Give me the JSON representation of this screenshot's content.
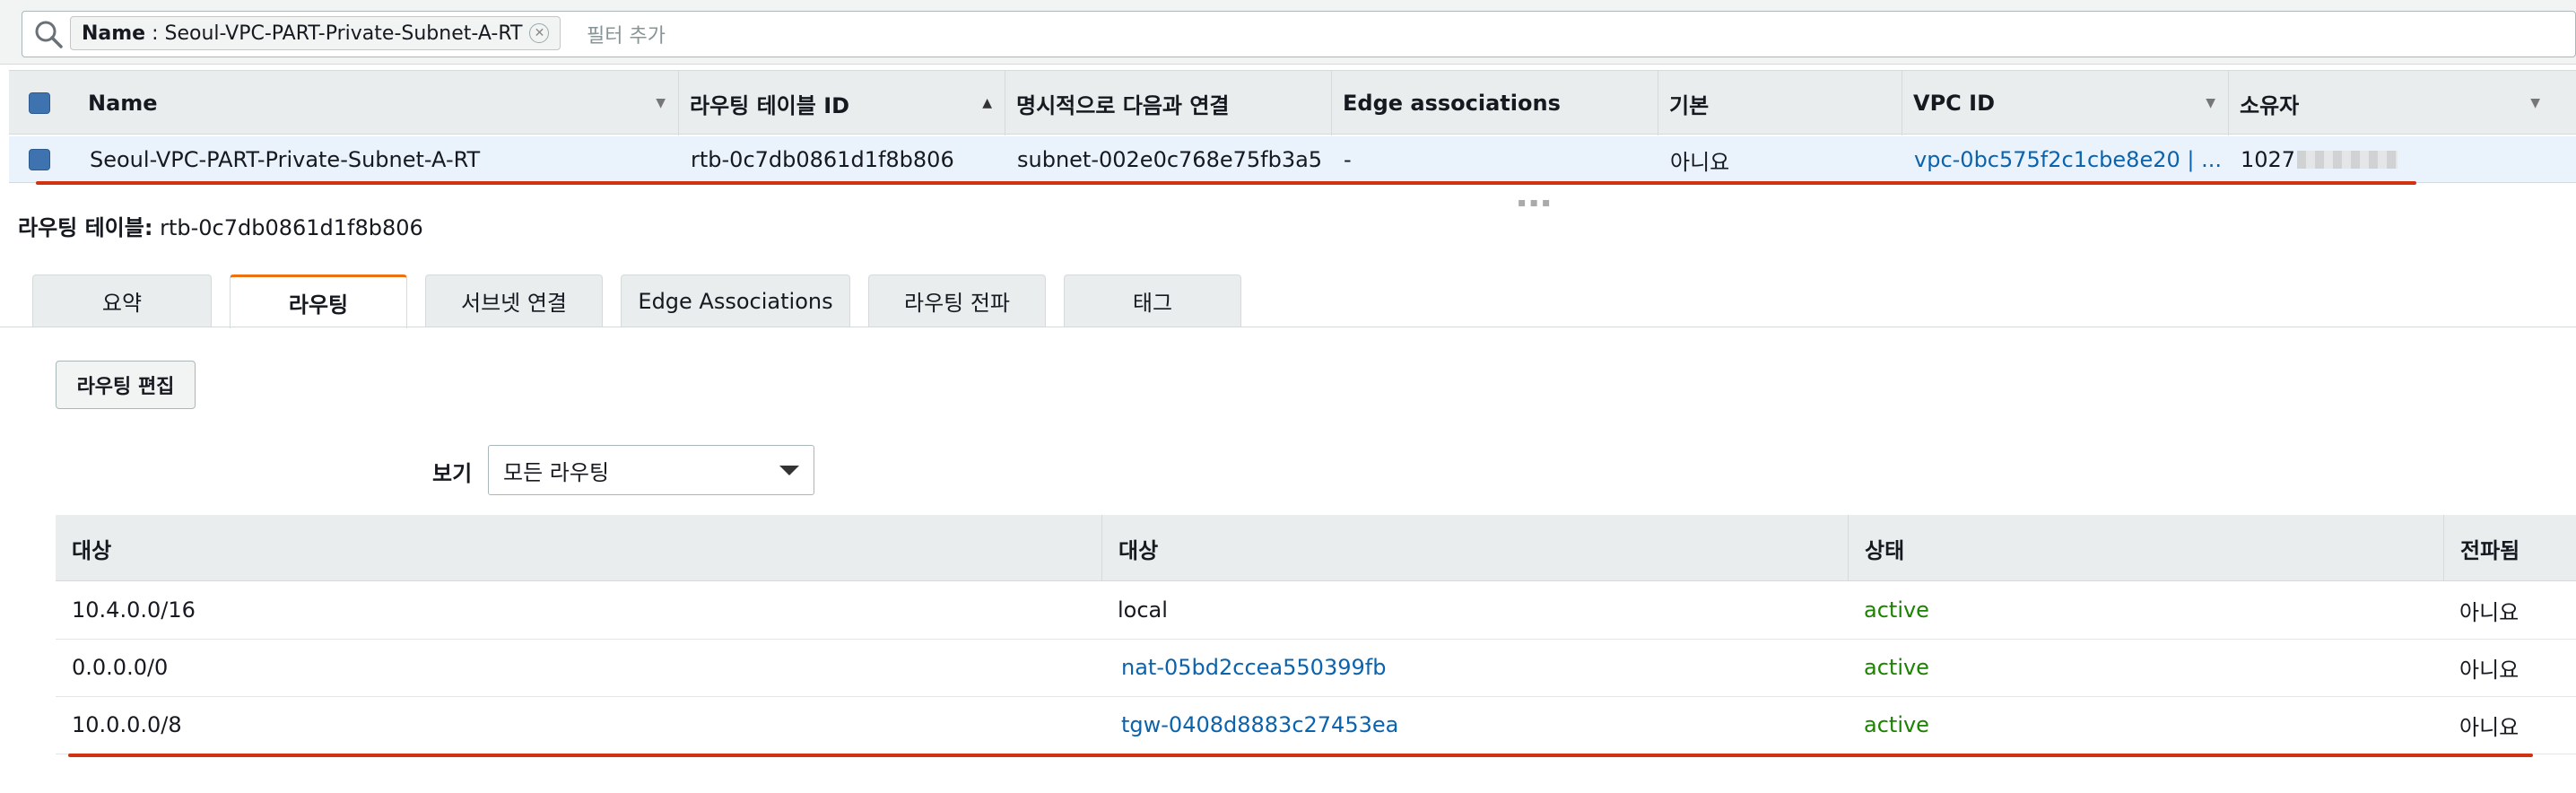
{
  "filter": {
    "token_key": "Name",
    "token_sep": " : ",
    "token_value": "Seoul-VPC-PART-Private-Subnet-A-RT",
    "add_placeholder": "필터 추가"
  },
  "route_tables": {
    "columns": [
      "Name",
      "라우팅 테이블 ID",
      "명시적으로 다음과 연결",
      "Edge associations",
      "기본",
      "VPC ID",
      "소유자"
    ],
    "rows": [
      {
        "name": "Seoul-VPC-PART-Private-Subnet-A-RT",
        "id": "rtb-0c7db0861d1f8b806",
        "explicit_assoc": "subnet-002e0c768e75fb3a5",
        "edge_assoc": "-",
        "main": "아니요",
        "vpc_id": "vpc-0bc575f2c1cbe8e20 | ...",
        "owner": "1027"
      }
    ]
  },
  "detail": {
    "label": "라우팅 테이블:",
    "value": "rtb-0c7db0861d1f8b806"
  },
  "tabs": [
    {
      "label": "요약"
    },
    {
      "label": "라우팅"
    },
    {
      "label": "서브넷 연결"
    },
    {
      "label": "Edge Associations"
    },
    {
      "label": "라우팅 전파"
    },
    {
      "label": "태그"
    }
  ],
  "active_tab": "라우팅",
  "routes": {
    "edit_button": "라우팅 편집",
    "view_label": "보기",
    "view_value": "모든 라우팅",
    "columns": [
      "대상",
      "대상",
      "상태",
      "전파됨"
    ],
    "rows": [
      {
        "destination": "10.4.0.0/16",
        "target": "local",
        "status": "active",
        "propagated": "아니요"
      },
      {
        "destination": "0.0.0.0/0",
        "target": "nat-05bd2ccea550399fb",
        "status": "active",
        "propagated": "아니요"
      },
      {
        "destination": "10.0.0.0/8",
        "target": "tgw-0408d8883c27453ea",
        "status": "active",
        "propagated": "아니요"
      }
    ]
  },
  "colors": {
    "accent_tab": "#ec7211",
    "link": "#0b63ad",
    "status_active": "#1d8102",
    "highlight_underline": "#d13212",
    "selected_row": "#eaf3fb"
  },
  "icons": [
    "search-icon",
    "close-circle-icon",
    "sort-down-icon",
    "sort-up-icon",
    "checkbox-icon",
    "dropdown-arrow-icon"
  ]
}
